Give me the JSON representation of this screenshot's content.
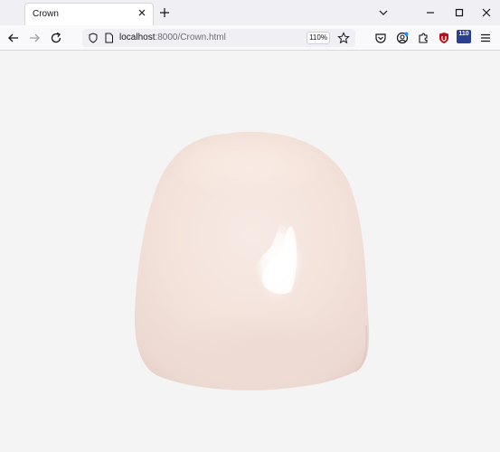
{
  "tab": {
    "title": "Crown"
  },
  "url": {
    "host": "localhost",
    "path": ":8000/Crown.html"
  },
  "zoom": "110%",
  "extension_badge": "110",
  "icons": {
    "tab_close": "close-icon",
    "new_tab": "plus-icon",
    "back": "arrow-left-icon",
    "forward": "arrow-right-icon",
    "reload": "reload-icon",
    "shield": "shield-icon",
    "page": "page-icon",
    "bookmark": "star-icon",
    "pocket": "pocket-icon",
    "account": "account-icon",
    "extensions": "puzzle-icon",
    "ublock": "ublock-icon",
    "menu": "hamburger-menu-icon"
  },
  "colors": {
    "tooth_base": "#f2e2da",
    "tooth_highlight": "#ffffff",
    "tooth_shadow": "#e6d2cb",
    "page_background": "#f4f4f4"
  }
}
